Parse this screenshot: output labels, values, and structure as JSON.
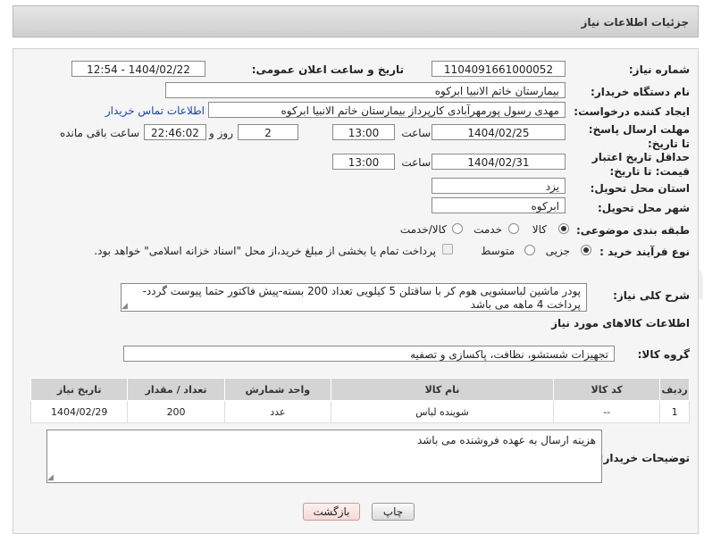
{
  "header": {
    "title": "جزئیات اطلاعات نیاز"
  },
  "fields": {
    "need_number_label": "شماره نیاز:",
    "need_number": "1104091661000052",
    "announce_label": "تاریخ و ساعت اعلان عمومی:",
    "announce_value": "1404/02/22 - 12:54",
    "buyer_org_label": "نام دستگاه خریدار:",
    "buyer_org": "بیمارستان خاتم الانبیا ابرکوه",
    "requester_label": "ایجاد کننده درخواست:",
    "requester": "مهدی رسول پورمهرآبادی کارپرداز بیمارستان خاتم الانبیا ابرکوه",
    "contact_link": "اطلاعات تماس خریدار",
    "deadline_label": "مهلت ارسال پاسخ: تا تاریخ:",
    "deadline_date": "1404/02/25",
    "time_label": "ساعت",
    "deadline_time": "13:00",
    "days_value": "2",
    "days_label": "روز و",
    "remaining_time": "22:46:02",
    "remaining_label": "ساعت باقی مانده",
    "validity_label": "حداقل تاریخ اعتبار قیمت: تا تاریخ:",
    "validity_date": "1404/02/31",
    "validity_time": "13:00",
    "province_label": "استان محل تحویل:",
    "province": "یزد",
    "city_label": "شهر محل تحویل:",
    "city": "ابرکوه",
    "category_label": "طبقه بندی موضوعی:",
    "category_options": [
      "کالا",
      "خدمت",
      "کالا/خدمت"
    ],
    "process_label": "نوع فرآیند خرید :",
    "process_options": [
      "جزیی",
      "متوسط"
    ],
    "payment_note": "پرداخت تمام یا بخشی از مبلغ خرید،از محل \"اسناد خزانه اسلامی\" خواهد بود.",
    "description_label": "شرح کلی نیاز:",
    "description": "پودر ماشین لباسشویی هوم کر با ساقتلن 5 کیلویی تعداد 200 بسته-پیش فاکتور حتما پیوست گردد-پرداخت 4 ماهه می باشد",
    "goods_info_title": "اطلاعات کالاهای مورد نیاز",
    "goods_group_label": "گروه کالا:",
    "goods_group": "تجهیزات شستشو، نظافت، پاکسازی و تصفیه",
    "buyer_notes_label": "توضیحات خریدار:",
    "buyer_notes": "هزینه ارسال به عهده فروشنده می باشد"
  },
  "table": {
    "headers": [
      "ردیف",
      "کد کالا",
      "نام کالا",
      "واحد شمارش",
      "تعداد / مقدار",
      "تاریخ نیاز"
    ],
    "rows": [
      [
        "1",
        "--",
        "شوینده لباس",
        "عدد",
        "200",
        "1404/02/29"
      ]
    ]
  },
  "buttons": {
    "print": "چاپ",
    "back": "بازگشت"
  },
  "colors": {
    "link": "#1a44b0",
    "header_bg": "#d9d9d9",
    "table_header": "#d4d4d4"
  }
}
